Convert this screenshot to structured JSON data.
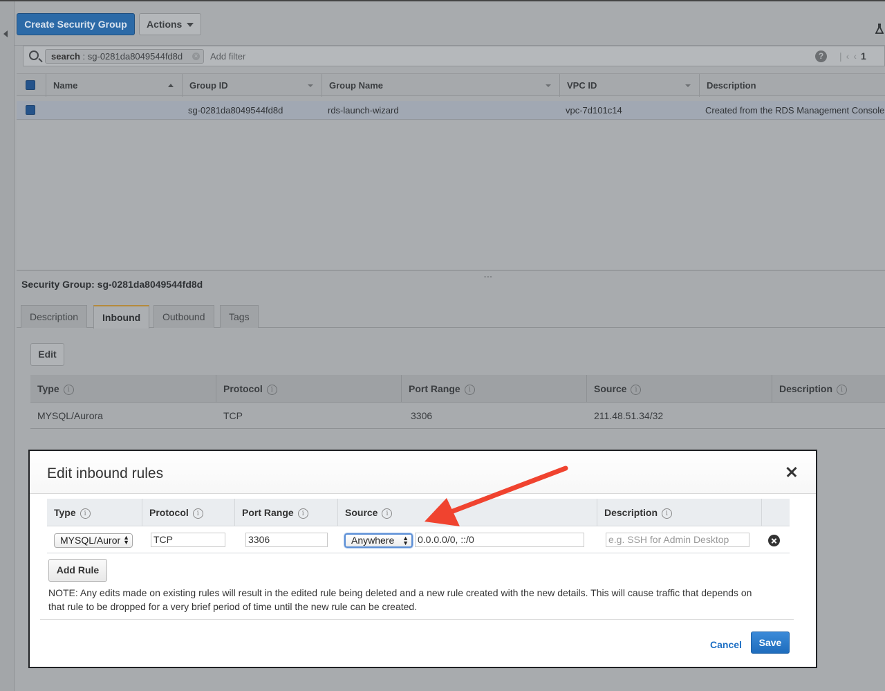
{
  "toolbar": {
    "create_label": "Create Security Group",
    "actions_label": "Actions"
  },
  "search": {
    "token_key": "search",
    "token_value": "sg-0281da8049544fd8d",
    "placeholder": "Add filter",
    "page_number": "1"
  },
  "grid": {
    "columns": [
      "Name",
      "Group ID",
      "Group Name",
      "VPC ID",
      "Description"
    ],
    "rows": [
      {
        "name": "",
        "group_id": "sg-0281da8049544fd8d",
        "group_name": "rds-launch-wizard",
        "vpc_id": "vpc-7d101c14",
        "description": "Created from the RDS Management Console"
      }
    ]
  },
  "details": {
    "title": "Security Group: sg-0281da8049544fd8d",
    "tabs": [
      "Description",
      "Inbound",
      "Outbound",
      "Tags"
    ],
    "active_tab": "Inbound",
    "edit_label": "Edit",
    "rule_columns": [
      "Type",
      "Protocol",
      "Port Range",
      "Source",
      "Description"
    ],
    "rules": [
      {
        "type": "MYSQL/Aurora",
        "protocol": "TCP",
        "port_range": "3306",
        "source": "211.48.51.34/32",
        "description": ""
      }
    ]
  },
  "modal": {
    "title": "Edit inbound rules",
    "columns": [
      "Type",
      "Protocol",
      "Port Range",
      "Source",
      "Description"
    ],
    "row": {
      "type": "MYSQL/Auror",
      "protocol": "TCP",
      "port_range": "3306",
      "source_select": "Anywhere",
      "source_value": "0.0.0.0/0, ::/0",
      "description_placeholder": "e.g. SSH for Admin Desktop"
    },
    "add_rule_label": "Add Rule",
    "note": "NOTE: Any edits made on existing rules will result in the edited rule being deleted and a new rule created with the new details. This will cause traffic that depends on that rule to be dropped for a very brief period of time until the new rule can be created.",
    "cancel_label": "Cancel",
    "save_label": "Save"
  },
  "colors": {
    "primary": "#2f7fd1",
    "annotation_arrow": "#f0432f",
    "tab_accent": "#e39d2c",
    "overlay": "#a8abae"
  },
  "icons": {
    "search": "search-icon",
    "help": "help-icon",
    "close": "close-icon",
    "remove": "remove-rule-icon",
    "info": "info-icon"
  }
}
